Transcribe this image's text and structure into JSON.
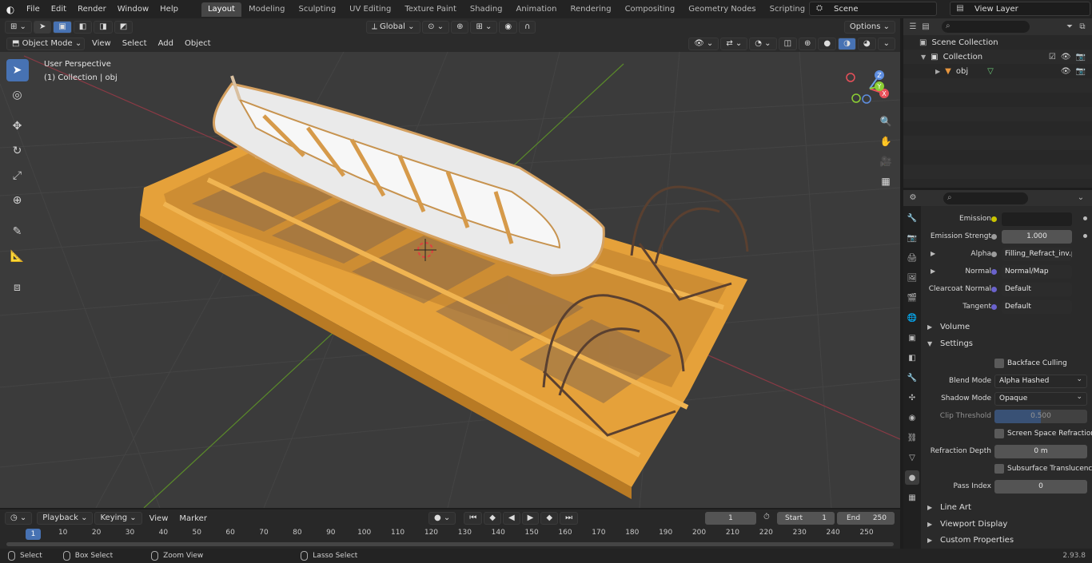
{
  "topbar": {
    "menus": [
      "File",
      "Edit",
      "Render",
      "Window",
      "Help"
    ],
    "workspaces": [
      "Layout",
      "Modeling",
      "Sculpting",
      "UV Editing",
      "Texture Paint",
      "Shading",
      "Animation",
      "Rendering",
      "Compositing",
      "Geometry Nodes",
      "Scripting"
    ],
    "active_workspace": "Layout",
    "scene": "Scene",
    "view_layer": "View Layer"
  },
  "viewport": {
    "mode": "Object Mode",
    "menus": [
      "View",
      "Select",
      "Add",
      "Object"
    ],
    "transform_orientation": "Global",
    "options_label": "Options",
    "title": "User Perspective",
    "subtitle": "(1) Collection | obj",
    "axis_labels": {
      "x": "X",
      "y": "Y",
      "z": "Z"
    }
  },
  "outliner": {
    "scene_collection": "Scene Collection",
    "collection": "Collection",
    "object": "obj"
  },
  "properties": {
    "emission_label": "Emission",
    "emission_strength_label": "Emission Strengt",
    "emission_strength": "1.000",
    "alpha_label": "Alpha",
    "alpha_value": "Filling_Refract_inv.p...",
    "normal_label": "Normal",
    "normal_value": "Normal/Map",
    "clearcoat_normal_label": "Clearcoat Normal",
    "clearcoat_normal_value": "Default",
    "tangent_label": "Tangent",
    "tangent_value": "Default",
    "volume": "Volume",
    "settings": "Settings",
    "backface_culling": "Backface Culling",
    "blend_mode_label": "Blend Mode",
    "blend_mode": "Alpha Hashed",
    "shadow_mode_label": "Shadow Mode",
    "shadow_mode": "Opaque",
    "clip_threshold_label": "Clip Threshold",
    "clip_threshold": "0.500",
    "clip_threshold_fraction": 0.5,
    "ss_refraction": "Screen Space Refraction",
    "refraction_depth_label": "Refraction Depth",
    "refraction_depth": "0 m",
    "subsurface_translucency": "Subsurface Translucency",
    "pass_index_label": "Pass Index",
    "pass_index": "0",
    "line_art": "Line Art",
    "viewport_display": "Viewport Display",
    "custom_properties": "Custom Properties"
  },
  "timeline": {
    "menus": [
      "Playback",
      "Keying",
      "View",
      "Marker"
    ],
    "current_frame": "1",
    "start_label": "Start",
    "start": "1",
    "end_label": "End",
    "end": "250",
    "ruler": [
      "10",
      "20",
      "30",
      "40",
      "50",
      "60",
      "70",
      "80",
      "90",
      "100",
      "110",
      "120",
      "130",
      "140",
      "150",
      "160",
      "170",
      "180",
      "190",
      "200",
      "210",
      "220",
      "230",
      "240",
      "250"
    ],
    "ruler_current": "1"
  },
  "statusbar": {
    "select": "Select",
    "box_select": "Box Select",
    "zoom_view": "Zoom View",
    "lasso_select": "Lasso Select",
    "version": "2.93.8"
  }
}
